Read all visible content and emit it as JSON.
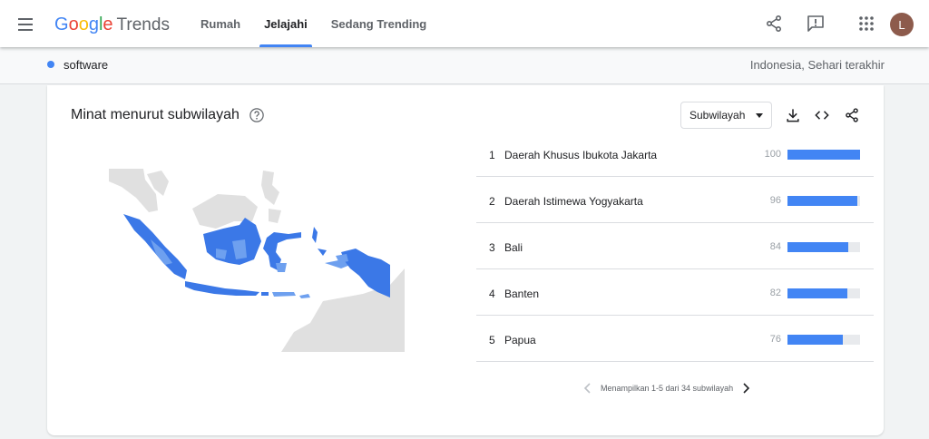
{
  "header": {
    "logo_parts": [
      "G",
      "o",
      "o",
      "g",
      "l",
      "e"
    ],
    "logo_suffix": "Trends",
    "nav": [
      {
        "label": "Rumah",
        "active": false
      },
      {
        "label": "Jelajahi",
        "active": true
      },
      {
        "label": "Sedang Trending",
        "active": false
      }
    ],
    "avatar_letter": "L",
    "icons": [
      "menu-icon",
      "share-icon",
      "feedback-icon",
      "apps-icon"
    ]
  },
  "subheader": {
    "term": "software",
    "term_color": "#4285f4",
    "scope": "Indonesia, Sehari terakhir"
  },
  "card": {
    "title": "Minat menurut subwilayah",
    "dropdown_value": "Subwilayah",
    "icons": [
      "help-icon",
      "download-icon",
      "embed-icon",
      "share-icon"
    ],
    "rows": [
      {
        "rank": "1",
        "region": "Daerah Khusus Ibukota Jakarta",
        "value": "100",
        "level": 100
      },
      {
        "rank": "2",
        "region": "Daerah Istimewa Yogyakarta",
        "value": "96",
        "level": 96
      },
      {
        "rank": "3",
        "region": "Bali",
        "value": "84",
        "level": 84
      },
      {
        "rank": "4",
        "region": "Banten",
        "value": "82",
        "level": 82
      },
      {
        "rank": "5",
        "region": "Papua",
        "value": "76",
        "level": 76
      }
    ],
    "pager_text": "Menampilkan 1-5 dari 34 subwilayah",
    "bar_color": "#4285f4",
    "bar_track_color": "#e8eaed"
  },
  "map": {
    "land_color": "#e0e0e0",
    "high_color": "#3b78e7",
    "mid_color": "#6ea0ef"
  }
}
